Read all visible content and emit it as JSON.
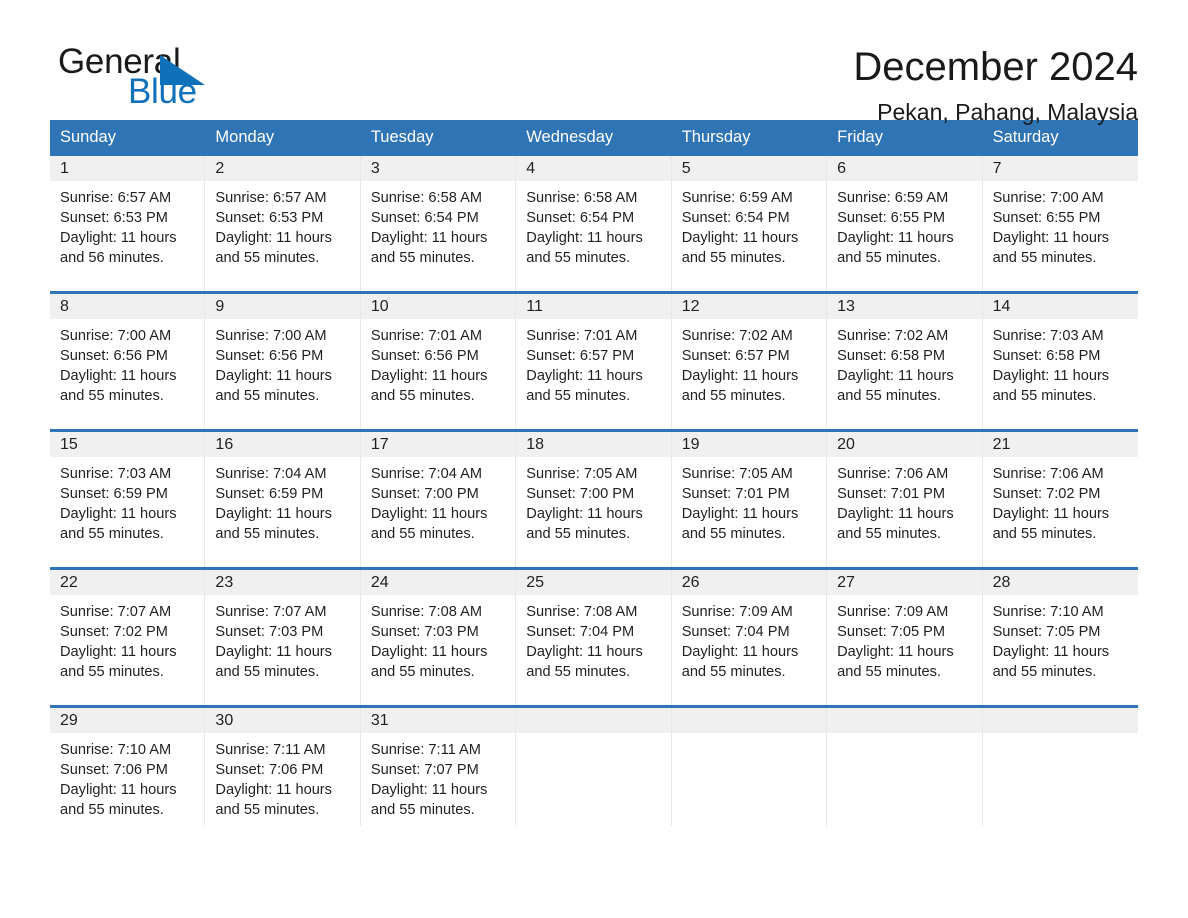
{
  "brand": {
    "name_part1": "General",
    "name_part2": "Blue",
    "triangle_color": "#1071bb",
    "text_color": "#1a1a1a"
  },
  "header": {
    "title": "December 2024",
    "location": "Pekan, Pahang, Malaysia"
  },
  "theme": {
    "header_blue": "#2f74b5",
    "daynum_band": "#f0f0f0",
    "text": "#231f20",
    "divider": "#e8e8e8"
  },
  "weekdays": [
    "Sunday",
    "Monday",
    "Tuesday",
    "Wednesday",
    "Thursday",
    "Friday",
    "Saturday"
  ],
  "weeks": [
    [
      {
        "day": "1",
        "sunrise": "Sunrise: 6:57 AM",
        "sunset": "Sunset: 6:53 PM",
        "daylight_line1": "Daylight: 11 hours",
        "daylight_line2": "and 56 minutes."
      },
      {
        "day": "2",
        "sunrise": "Sunrise: 6:57 AM",
        "sunset": "Sunset: 6:53 PM",
        "daylight_line1": "Daylight: 11 hours",
        "daylight_line2": "and 55 minutes."
      },
      {
        "day": "3",
        "sunrise": "Sunrise: 6:58 AM",
        "sunset": "Sunset: 6:54 PM",
        "daylight_line1": "Daylight: 11 hours",
        "daylight_line2": "and 55 minutes."
      },
      {
        "day": "4",
        "sunrise": "Sunrise: 6:58 AM",
        "sunset": "Sunset: 6:54 PM",
        "daylight_line1": "Daylight: 11 hours",
        "daylight_line2": "and 55 minutes."
      },
      {
        "day": "5",
        "sunrise": "Sunrise: 6:59 AM",
        "sunset": "Sunset: 6:54 PM",
        "daylight_line1": "Daylight: 11 hours",
        "daylight_line2": "and 55 minutes."
      },
      {
        "day": "6",
        "sunrise": "Sunrise: 6:59 AM",
        "sunset": "Sunset: 6:55 PM",
        "daylight_line1": "Daylight: 11 hours",
        "daylight_line2": "and 55 minutes."
      },
      {
        "day": "7",
        "sunrise": "Sunrise: 7:00 AM",
        "sunset": "Sunset: 6:55 PM",
        "daylight_line1": "Daylight: 11 hours",
        "daylight_line2": "and 55 minutes."
      }
    ],
    [
      {
        "day": "8",
        "sunrise": "Sunrise: 7:00 AM",
        "sunset": "Sunset: 6:56 PM",
        "daylight_line1": "Daylight: 11 hours",
        "daylight_line2": "and 55 minutes."
      },
      {
        "day": "9",
        "sunrise": "Sunrise: 7:00 AM",
        "sunset": "Sunset: 6:56 PM",
        "daylight_line1": "Daylight: 11 hours",
        "daylight_line2": "and 55 minutes."
      },
      {
        "day": "10",
        "sunrise": "Sunrise: 7:01 AM",
        "sunset": "Sunset: 6:56 PM",
        "daylight_line1": "Daylight: 11 hours",
        "daylight_line2": "and 55 minutes."
      },
      {
        "day": "11",
        "sunrise": "Sunrise: 7:01 AM",
        "sunset": "Sunset: 6:57 PM",
        "daylight_line1": "Daylight: 11 hours",
        "daylight_line2": "and 55 minutes."
      },
      {
        "day": "12",
        "sunrise": "Sunrise: 7:02 AM",
        "sunset": "Sunset: 6:57 PM",
        "daylight_line1": "Daylight: 11 hours",
        "daylight_line2": "and 55 minutes."
      },
      {
        "day": "13",
        "sunrise": "Sunrise: 7:02 AM",
        "sunset": "Sunset: 6:58 PM",
        "daylight_line1": "Daylight: 11 hours",
        "daylight_line2": "and 55 minutes."
      },
      {
        "day": "14",
        "sunrise": "Sunrise: 7:03 AM",
        "sunset": "Sunset: 6:58 PM",
        "daylight_line1": "Daylight: 11 hours",
        "daylight_line2": "and 55 minutes."
      }
    ],
    [
      {
        "day": "15",
        "sunrise": "Sunrise: 7:03 AM",
        "sunset": "Sunset: 6:59 PM",
        "daylight_line1": "Daylight: 11 hours",
        "daylight_line2": "and 55 minutes."
      },
      {
        "day": "16",
        "sunrise": "Sunrise: 7:04 AM",
        "sunset": "Sunset: 6:59 PM",
        "daylight_line1": "Daylight: 11 hours",
        "daylight_line2": "and 55 minutes."
      },
      {
        "day": "17",
        "sunrise": "Sunrise: 7:04 AM",
        "sunset": "Sunset: 7:00 PM",
        "daylight_line1": "Daylight: 11 hours",
        "daylight_line2": "and 55 minutes."
      },
      {
        "day": "18",
        "sunrise": "Sunrise: 7:05 AM",
        "sunset": "Sunset: 7:00 PM",
        "daylight_line1": "Daylight: 11 hours",
        "daylight_line2": "and 55 minutes."
      },
      {
        "day": "19",
        "sunrise": "Sunrise: 7:05 AM",
        "sunset": "Sunset: 7:01 PM",
        "daylight_line1": "Daylight: 11 hours",
        "daylight_line2": "and 55 minutes."
      },
      {
        "day": "20",
        "sunrise": "Sunrise: 7:06 AM",
        "sunset": "Sunset: 7:01 PM",
        "daylight_line1": "Daylight: 11 hours",
        "daylight_line2": "and 55 minutes."
      },
      {
        "day": "21",
        "sunrise": "Sunrise: 7:06 AM",
        "sunset": "Sunset: 7:02 PM",
        "daylight_line1": "Daylight: 11 hours",
        "daylight_line2": "and 55 minutes."
      }
    ],
    [
      {
        "day": "22",
        "sunrise": "Sunrise: 7:07 AM",
        "sunset": "Sunset: 7:02 PM",
        "daylight_line1": "Daylight: 11 hours",
        "daylight_line2": "and 55 minutes."
      },
      {
        "day": "23",
        "sunrise": "Sunrise: 7:07 AM",
        "sunset": "Sunset: 7:03 PM",
        "daylight_line1": "Daylight: 11 hours",
        "daylight_line2": "and 55 minutes."
      },
      {
        "day": "24",
        "sunrise": "Sunrise: 7:08 AM",
        "sunset": "Sunset: 7:03 PM",
        "daylight_line1": "Daylight: 11 hours",
        "daylight_line2": "and 55 minutes."
      },
      {
        "day": "25",
        "sunrise": "Sunrise: 7:08 AM",
        "sunset": "Sunset: 7:04 PM",
        "daylight_line1": "Daylight: 11 hours",
        "daylight_line2": "and 55 minutes."
      },
      {
        "day": "26",
        "sunrise": "Sunrise: 7:09 AM",
        "sunset": "Sunset: 7:04 PM",
        "daylight_line1": "Daylight: 11 hours",
        "daylight_line2": "and 55 minutes."
      },
      {
        "day": "27",
        "sunrise": "Sunrise: 7:09 AM",
        "sunset": "Sunset: 7:05 PM",
        "daylight_line1": "Daylight: 11 hours",
        "daylight_line2": "and 55 minutes."
      },
      {
        "day": "28",
        "sunrise": "Sunrise: 7:10 AM",
        "sunset": "Sunset: 7:05 PM",
        "daylight_line1": "Daylight: 11 hours",
        "daylight_line2": "and 55 minutes."
      }
    ],
    [
      {
        "day": "29",
        "sunrise": "Sunrise: 7:10 AM",
        "sunset": "Sunset: 7:06 PM",
        "daylight_line1": "Daylight: 11 hours",
        "daylight_line2": "and 55 minutes."
      },
      {
        "day": "30",
        "sunrise": "Sunrise: 7:11 AM",
        "sunset": "Sunset: 7:06 PM",
        "daylight_line1": "Daylight: 11 hours",
        "daylight_line2": "and 55 minutes."
      },
      {
        "day": "31",
        "sunrise": "Sunrise: 7:11 AM",
        "sunset": "Sunset: 7:07 PM",
        "daylight_line1": "Daylight: 11 hours",
        "daylight_line2": "and 55 minutes."
      },
      {
        "day": "",
        "sunrise": "",
        "sunset": "",
        "daylight_line1": "",
        "daylight_line2": ""
      },
      {
        "day": "",
        "sunrise": "",
        "sunset": "",
        "daylight_line1": "",
        "daylight_line2": ""
      },
      {
        "day": "",
        "sunrise": "",
        "sunset": "",
        "daylight_line1": "",
        "daylight_line2": ""
      },
      {
        "day": "",
        "sunrise": "",
        "sunset": "",
        "daylight_line1": "",
        "daylight_line2": ""
      }
    ]
  ]
}
